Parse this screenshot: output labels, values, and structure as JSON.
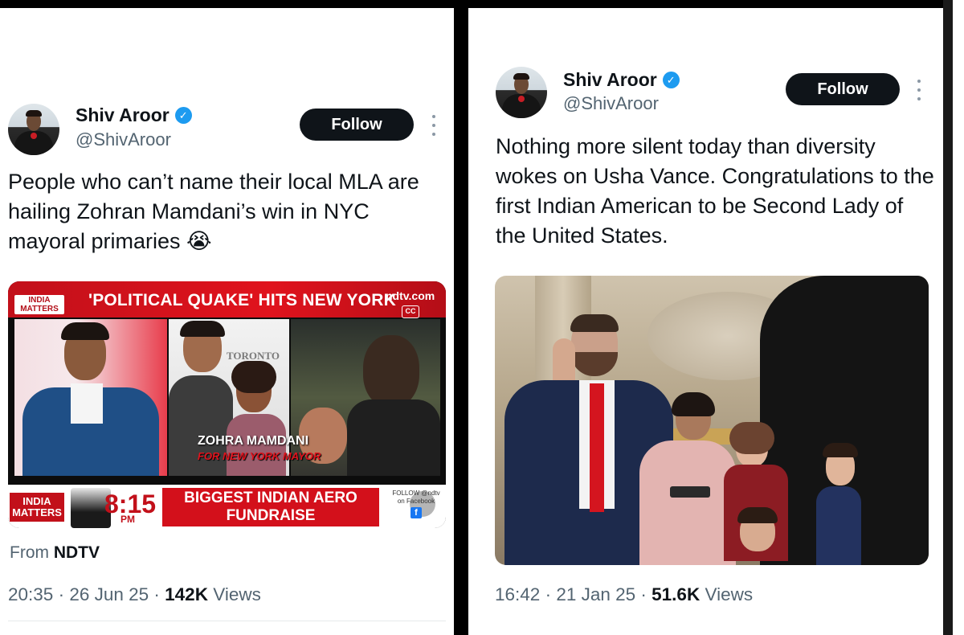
{
  "left_tweet": {
    "author": {
      "name": "Shiv Aroor",
      "handle": "@ShivAroor"
    },
    "follow_label": "Follow",
    "text": "People who can’t name their local MLA are hailing Zohran Mamdani’s win in NYC mayoral primaries 😭",
    "media": {
      "logo_top": "INDIA MATTERS",
      "headline_top": "'POLITICAL QUAKE' HITS NEW YORK",
      "watermark": "ndtv.com",
      "cc_label": "CC",
      "poster_text": "TORONTO",
      "caption_name": "ZOHRA MAMDANI",
      "caption_sub": "FOR NEW YORK MAYOR",
      "logo_bottom": "INDIA MATTERS",
      "time": "8:15",
      "time_suffix": "PM",
      "headline_bottom": "BIGGEST INDIAN AERO FUNDRAISE",
      "follow_text": "FOLLOW @ndtv on Facebook"
    },
    "source_prefix": "From",
    "source": "NDTV",
    "meta": {
      "time": "20:35",
      "date": "26 Jun 25",
      "views_count": "142K",
      "views_label": "Views"
    }
  },
  "right_tweet": {
    "author": {
      "name": "Shiv Aroor",
      "handle": "@ShivAroor"
    },
    "follow_label": "Follow",
    "text": "Nothing more silent today than diversity wokes on Usha Vance. Congratulations to the first Indian American to be Second Lady of the United States.",
    "meta": {
      "time": "16:42",
      "date": "21 Jan 25",
      "views_count": "51.6K",
      "views_label": "Views"
    }
  },
  "colors": {
    "verified": "#1d9bf0",
    "follow_button": "#0f1419",
    "ndtv_red": "#d3101b"
  },
  "icons": [
    "verified-badge-icon",
    "more-options-icon",
    "closed-captions-icon",
    "mute-icon",
    "facebook-icon"
  ]
}
